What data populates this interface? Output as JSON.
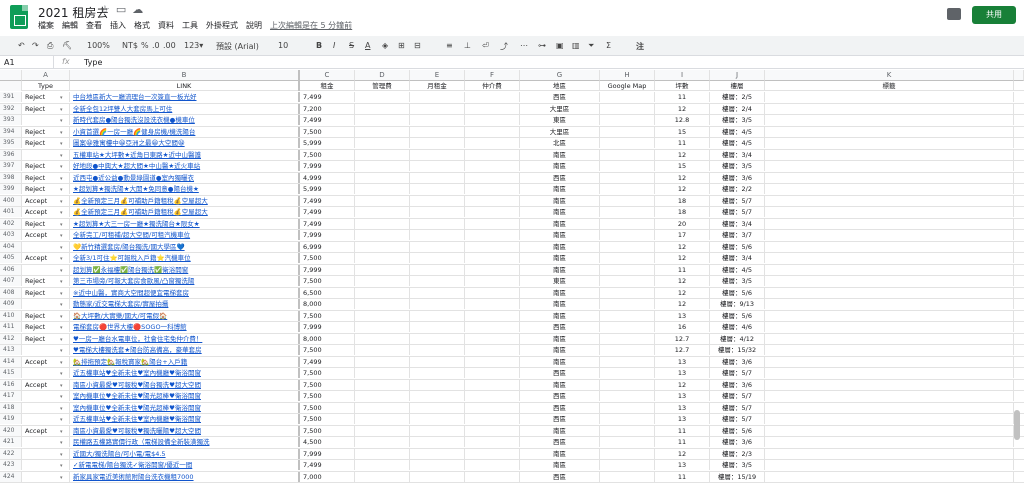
{
  "app": {
    "title": "2021 租房去",
    "menu": [
      "檔案",
      "編輯",
      "查看",
      "插入",
      "格式",
      "資料",
      "工具",
      "外掛程式",
      "說明"
    ],
    "last_edit": "上次編輯是在 5 分鐘前",
    "share_label": "共用",
    "accent": "#188038"
  },
  "toolbar": {
    "zoom": "100%",
    "currency": "NT$",
    "percent": "%",
    "dec1": ".0",
    "dec2": ".00",
    "fmt": "123▾",
    "font": "預設 (Arial)",
    "size": "10"
  },
  "formula_bar": {
    "cell_ref": "A1",
    "fx": "fx",
    "value": "Type"
  },
  "columns": [
    "A",
    "B",
    "C",
    "D",
    "E",
    "F",
    "G",
    "H",
    "I",
    "J",
    "K"
  ],
  "headers": [
    "Type",
    "LINK",
    "租金",
    "管理費",
    "月租金",
    "仲介費",
    "地區",
    "Google Map",
    "坪數",
    "樓層",
    "標籤"
  ],
  "rows": [
    {
      "n": "391",
      "type": "Reject",
      "link": "中台地區新大一廳流理台一次簽直一板光好",
      "rent": "7,499",
      "area": "西區",
      "size": "11",
      "floor": "樓層：2/5"
    },
    {
      "n": "392",
      "type": "Reject",
      "link": "全新全包12坪雙人大套房馬上可住",
      "rent": "7,200",
      "area": "大里區",
      "size": "12",
      "floor": "樓層：2/4"
    },
    {
      "n": "393",
      "type": "",
      "link": "新時代套房●陽台獨洗沒設洗衣機●機車位",
      "rent": "7,499",
      "area": "東區",
      "size": "12.8",
      "floor": "樓層：3/5"
    },
    {
      "n": "394",
      "type": "Reject",
      "link": "小資首選🌈一房一廳🌈健身房機/機洗陽台",
      "rent": "7,500",
      "area": "大里區",
      "size": "15",
      "floor": "樓層：4/5"
    },
    {
      "n": "395",
      "type": "Reject",
      "link": "圖案😀雅寓樓中😀亞洲之最😀大空間😀",
      "rent": "5,999",
      "area": "北區",
      "size": "11",
      "floor": "樓層：4/5"
    },
    {
      "n": "396",
      "type": "",
      "link": "五權車站★大坪數★近角日東路★近中山醫護",
      "rent": "7,500",
      "area": "南區",
      "size": "12",
      "floor": "樓層：3/4"
    },
    {
      "n": "397",
      "type": "Reject",
      "link": "好地段●中興大★超大間★中山醫★近火車站",
      "rent": "7,999",
      "area": "南區",
      "size": "15",
      "floor": "樓層：3/5"
    },
    {
      "n": "398",
      "type": "Reject",
      "link": "近西屯●近公益●動景綠園道●室內獨曬衣",
      "rent": "4,999",
      "area": "西區",
      "size": "12",
      "floor": "樓層：3/6"
    },
    {
      "n": "399",
      "type": "Reject",
      "link": "★超划算★獨洗陽★大開★免同意●陽台機★",
      "rent": "5,999",
      "area": "南區",
      "size": "12",
      "floor": "樓層：2/2"
    },
    {
      "n": "400",
      "type": "Accept",
      "link": "💰全新預定三月💰可補助戶籍租稅💰空屋超大",
      "rent": "7,499",
      "area": "南區",
      "size": "18",
      "floor": "樓層：5/7"
    },
    {
      "n": "401",
      "type": "Accept",
      "link": "💰全新預定三月💰可補助戶籍租稅💰空屋超大",
      "rent": "7,499",
      "area": "南區",
      "size": "18",
      "floor": "樓層：5/7"
    },
    {
      "n": "402",
      "type": "Reject",
      "link": "★超划算★大三一房一廳★獨洗陽台★限女★",
      "rent": "7,499",
      "area": "南區",
      "size": "20",
      "floor": "樓層：3/4"
    },
    {
      "n": "403",
      "type": "Accept",
      "link": "全新完工/可租補/超大空間/可租汽機車位",
      "rent": "7,999",
      "area": "南區",
      "size": "17",
      "floor": "樓層：3/7"
    },
    {
      "n": "404",
      "type": "",
      "link": "💛新竹精選套房/陽台獨洗/國大學區💙",
      "rent": "6,999",
      "area": "南區",
      "size": "12",
      "floor": "樓層：5/6"
    },
    {
      "n": "405",
      "type": "Accept",
      "link": "全新3/1可住⭐可報稅入戶籍⭐汽機車位",
      "rent": "7,500",
      "area": "南區",
      "size": "12",
      "floor": "樓層：3/4"
    },
    {
      "n": "406",
      "type": "",
      "link": "超划算✅永福樓✅陽台獨洗✅衛浴開窗",
      "rent": "7,999",
      "area": "南區",
      "size": "11",
      "floor": "樓層：4/5"
    },
    {
      "n": "407",
      "type": "Reject",
      "link": "第三市場旁/可報大套房食歐風/凸窗獨洗陽",
      "rent": "7,500",
      "area": "東區",
      "size": "12",
      "floor": "樓層：3/5"
    },
    {
      "n": "408",
      "type": "Reject",
      "link": "※近中山醫，實商大空間超便宜電梯套房",
      "rent": "6,500",
      "area": "南區",
      "size": "12",
      "floor": "樓層：5/6"
    },
    {
      "n": "409",
      "type": "",
      "link": "動態家/近交電梯大套房/實屋拍攝",
      "rent": "8,000",
      "area": "南區",
      "size": "12",
      "floor": "樓層：9/13"
    },
    {
      "n": "410",
      "type": "Reject",
      "link": "🏠大坪數/大實樂/國大/可電假🏠",
      "rent": "7,500",
      "area": "南區",
      "size": "13",
      "floor": "樓層：5/6"
    },
    {
      "n": "411",
      "type": "Reject",
      "link": "電梯套房🔴世界大樓🔴SOGO一科博館",
      "rent": "7,999",
      "area": "西區",
      "size": "16",
      "floor": "樓層：4/6"
    },
    {
      "n": "412",
      "type": "Reject",
      "link": "♥一房一廳台水電車位，社會住宅免仲介費！",
      "rent": "8,000",
      "area": "南區",
      "size": "12.7",
      "floor": "樓層：4/12"
    },
    {
      "n": "413",
      "type": "",
      "link": "♥電梯大樓獨洗套★陽台防高備高，豪華套房",
      "rent": "7,500",
      "area": "南區",
      "size": "12.7",
      "floor": "樓層：15/32"
    },
    {
      "n": "414",
      "type": "Accept",
      "link": "🏡排拖預定🏡報稅寶家🏡陽台+入戶籍",
      "rent": "7,499",
      "area": "南區",
      "size": "13",
      "floor": "樓層：3/6"
    },
    {
      "n": "415",
      "type": "",
      "link": "近五權車站♥全新未住♥室內機廳♥衛浴開窗",
      "rent": "7,500",
      "area": "西區",
      "size": "13",
      "floor": "樓層：5/7"
    },
    {
      "n": "416",
      "type": "Accept",
      "link": "南區小資最愛♥可報稅♥陽台獨洗♥超大空間",
      "rent": "7,500",
      "area": "南區",
      "size": "12",
      "floor": "樓層：3/6"
    },
    {
      "n": "417",
      "type": "",
      "link": "室內機車位♥全新未住♥陽光超棒♥衛浴開窗",
      "rent": "7,500",
      "area": "西區",
      "size": "13",
      "floor": "樓層：5/7"
    },
    {
      "n": "418",
      "type": "",
      "link": "室內機車位♥全新未住♥陽光超棒♥衛浴開窗",
      "rent": "7,500",
      "area": "西區",
      "size": "13",
      "floor": "樓層：5/7"
    },
    {
      "n": "419",
      "type": "",
      "link": "近五權車站♥全新未住♥室內機廳♥衛浴開窗",
      "rent": "7,500",
      "area": "西區",
      "size": "13",
      "floor": "樓層：5/7"
    },
    {
      "n": "420",
      "type": "Accept",
      "link": "南區小資最愛♥可報稅♥獨洗曬陽♥超大空間",
      "rent": "7,500",
      "area": "南區",
      "size": "11",
      "floor": "樓層：5/6"
    },
    {
      "n": "421",
      "type": "",
      "link": "民權路五權路實價行政（電梯設備全新裝潢獨洗",
      "rent": "4,500",
      "area": "西區",
      "size": "11",
      "floor": "樓層：3/6"
    },
    {
      "n": "422",
      "type": "",
      "link": "近國大/獨洗陽台/可小電/電$4.5",
      "rent": "7,999",
      "area": "南區",
      "size": "12",
      "floor": "樓層：2/3"
    },
    {
      "n": "423",
      "type": "",
      "link": "✓新電電梯/陽台獨洗✓衛浴開窗/優近一間",
      "rent": "7,499",
      "area": "南區",
      "size": "13",
      "floor": "樓層：3/5"
    },
    {
      "n": "424",
      "type": "",
      "link": "新家具家電近美術館附陽台洗衣機租7000",
      "rent": "7,000",
      "area": "西區",
      "size": "11",
      "floor": "樓層：15/19"
    }
  ]
}
